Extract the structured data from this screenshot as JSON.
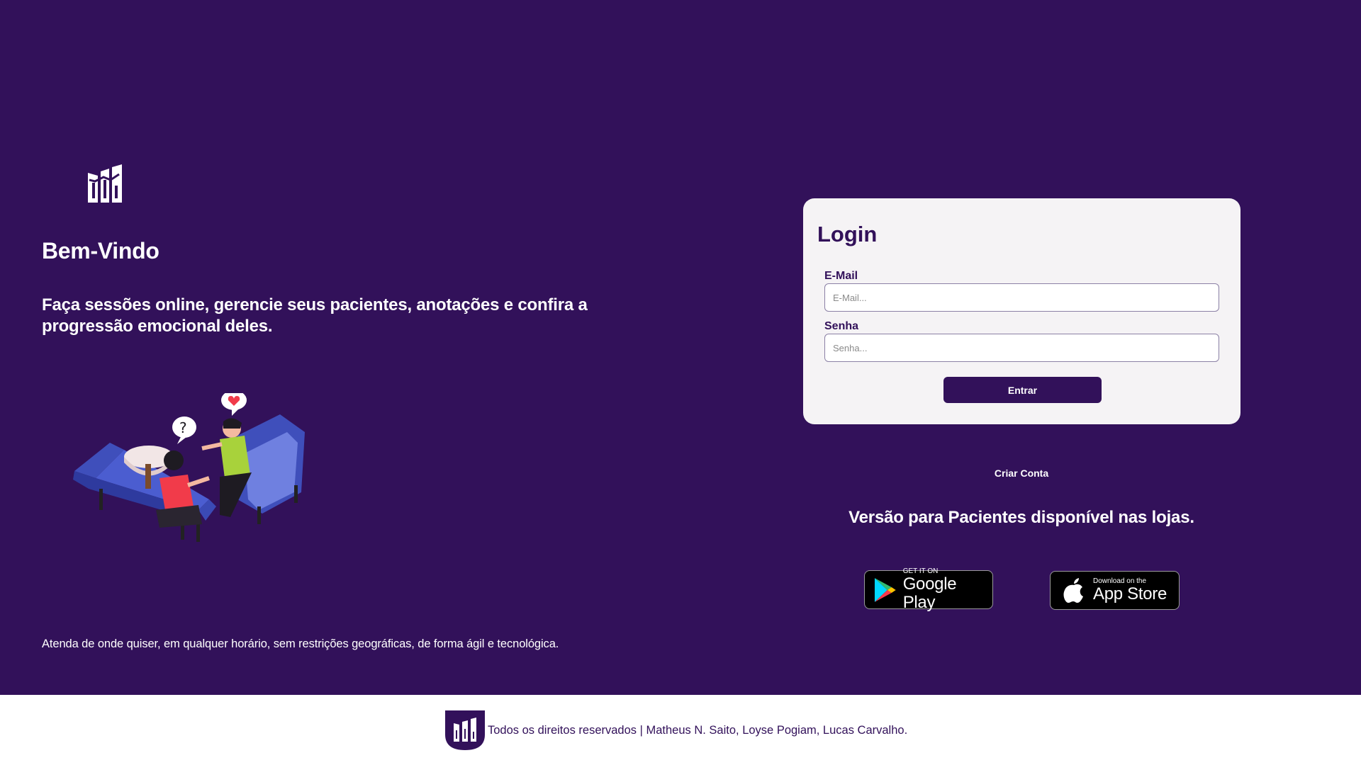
{
  "welcome": {
    "title": "Bem-Vindo",
    "subtitle": "Faça sessões online, gerencie seus pacientes, anotações e confira a progressão emocional deles.",
    "tagline": "Atenda de onde quiser, em qualquer horário, sem restrições geográficas, de forma ágil e tecnológica."
  },
  "login": {
    "title": "Login",
    "email_label": "E-Mail",
    "email_placeholder": "E-Mail...",
    "email_value": "",
    "password_label": "Senha",
    "password_placeholder": "Senha...",
    "password_value": "",
    "submit_label": "Entrar"
  },
  "create_account_label": "Criar Conta",
  "stores": {
    "heading": "Versão para Pacientes disponível nas lojas.",
    "google_play": {
      "small": "GET IT ON",
      "big": "Google Play",
      "icon": "google-play-icon"
    },
    "app_store": {
      "small": "Download on the",
      "big": "App Store",
      "icon": "apple-icon"
    }
  },
  "footer": {
    "text": "Todos os direitos reservados | Matheus N. Saito, Loyse Pogiam, Lucas Carvalho."
  },
  "colors": {
    "brand_purple": "#32115a",
    "card_bg": "#f5f3f5",
    "footer_bg": "#ffffff"
  }
}
